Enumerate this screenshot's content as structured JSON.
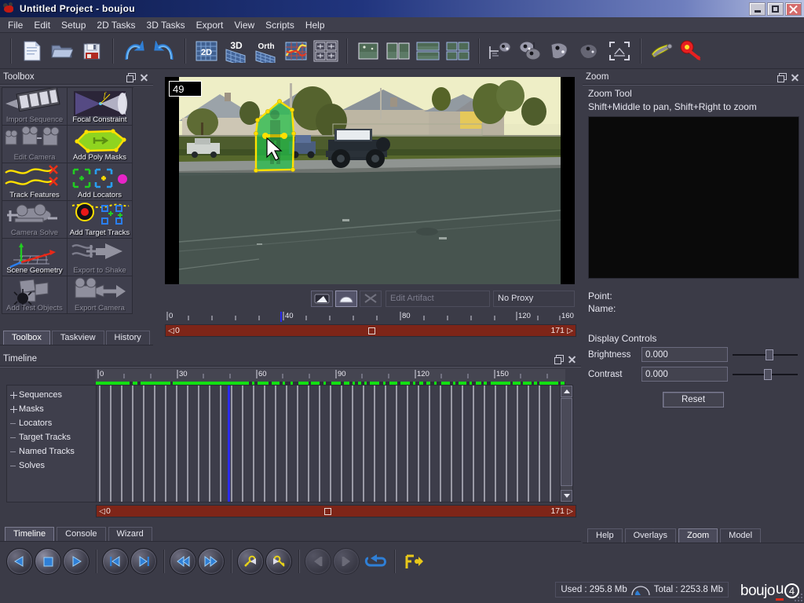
{
  "window": {
    "title": "Untitled Project - boujou",
    "icon": "boujou-app-icon",
    "buttons": {
      "minimize": "minimize",
      "maximize": "maximize",
      "close": "close"
    }
  },
  "menu": {
    "items": [
      "File",
      "Edit",
      "Setup",
      "2D Tasks",
      "3D Tasks",
      "Export",
      "View",
      "Scripts",
      "Help"
    ]
  },
  "toolbar": {
    "groups": [
      {
        "buttons": [
          {
            "name": "new-project-icon",
            "tip": "New"
          },
          {
            "name": "open-project-icon",
            "tip": "Open"
          },
          {
            "name": "save-project-icon",
            "tip": "Save"
          }
        ]
      },
      {
        "buttons": [
          {
            "name": "undo-icon",
            "tip": "Undo"
          },
          {
            "name": "redo-icon",
            "tip": "Redo"
          }
        ]
      },
      {
        "buttons": [
          {
            "name": "view-2d-icon",
            "tip": "2D",
            "label": "2D"
          },
          {
            "name": "view-3d-icon",
            "tip": "3D",
            "label": "3D"
          },
          {
            "name": "view-orth-icon",
            "tip": "Orth",
            "label": "Orth"
          },
          {
            "name": "view-graph-icon",
            "tip": "Graph"
          },
          {
            "name": "view-split-grid-icon",
            "tip": "Quad layout"
          }
        ]
      },
      {
        "buttons": [
          {
            "name": "layout-single-icon",
            "tip": "Single view"
          },
          {
            "name": "layout-two-up-icon",
            "tip": "Two views"
          },
          {
            "name": "layout-stacked-icon",
            "tip": "Stacked views"
          },
          {
            "name": "layout-quad-icon",
            "tip": "Four views"
          }
        ]
      },
      {
        "buttons": [
          {
            "name": "camera-path-icon",
            "tip": "Camera path"
          },
          {
            "name": "multi-camera-icon",
            "tip": "Cameras"
          },
          {
            "name": "camera-single-icon",
            "tip": "Camera"
          },
          {
            "name": "camera-ghost-icon",
            "tip": "Ghost camera"
          },
          {
            "name": "frame-bounds-icon",
            "tip": "Frame selection"
          }
        ]
      },
      {
        "buttons": [
          {
            "name": "mask-paint-icon",
            "tip": "Mask tool"
          },
          {
            "name": "target-track-icon",
            "tip": "Target track tool"
          }
        ]
      }
    ]
  },
  "toolbox": {
    "title": "Toolbox",
    "items": [
      {
        "label": "Import Sequence",
        "icon": "film-strip-icon",
        "enabled": false
      },
      {
        "label": "Focal Constraint",
        "icon": "focal-cone-icon",
        "enabled": true
      },
      {
        "label": "Edit Camera",
        "icon": "cameras-icon",
        "enabled": false
      },
      {
        "label": "Add Poly Masks",
        "icon": "poly-mask-icon",
        "enabled": true
      },
      {
        "label": "Track Features",
        "icon": "track-features-icon",
        "enabled": true
      },
      {
        "label": "Add Locators",
        "icon": "locators-icon",
        "enabled": true
      },
      {
        "label": "Camera Solve",
        "icon": "camera-solve-icon",
        "enabled": false
      },
      {
        "label": "Add Target Tracks",
        "icon": "target-tracks-icon",
        "enabled": true
      },
      {
        "label": "Scene Geometry",
        "icon": "scene-geometry-icon",
        "enabled": true
      },
      {
        "label": "Export to Shake",
        "icon": "export-shake-icon",
        "enabled": false
      },
      {
        "label": "Add Test Objects",
        "icon": "test-objects-icon",
        "enabled": false
      },
      {
        "label": "Export Camera",
        "icon": "export-camera-icon",
        "enabled": false
      }
    ],
    "tabs": [
      {
        "label": "Toolbox",
        "active": true
      },
      {
        "label": "Taskview",
        "active": false
      },
      {
        "label": "History",
        "active": false
      }
    ]
  },
  "viewport": {
    "frame_number": "49",
    "tools": [
      {
        "name": "pan-tool-icon",
        "enabled": true,
        "active": false
      },
      {
        "name": "mask-tool-icon",
        "enabled": true,
        "active": true
      },
      {
        "name": "cut-tool-icon",
        "enabled": false,
        "active": false
      }
    ],
    "artifact_field": {
      "placeholder": "Edit Artifact",
      "value": ""
    },
    "proxy": "No Proxy",
    "ruler": {
      "ticks": [
        0,
        40,
        80,
        120,
        160
      ],
      "min": 0,
      "max": 171,
      "step": 10
    },
    "range": {
      "start": "0",
      "end": "171",
      "current": "49"
    },
    "scene": {
      "description": "Suburban street at golden hour with parked jeep and person highlighted by green poly mask",
      "mask_color": "#22c04a",
      "mask_outline_color": "#ffe000"
    }
  },
  "timeline": {
    "title": "Timeline",
    "tree": [
      {
        "label": "Sequences",
        "expander": "plus"
      },
      {
        "label": "Masks",
        "expander": "plus"
      },
      {
        "label": "Locators",
        "expander": "dot"
      },
      {
        "label": "Target Tracks",
        "expander": "dot"
      },
      {
        "label": "Named Tracks",
        "expander": "dot"
      },
      {
        "label": "Solves",
        "expander": "dot"
      }
    ],
    "ruler": {
      "ticks": [
        0,
        30,
        60,
        90,
        120,
        150
      ],
      "min": 0,
      "max": 171
    },
    "playhead_frame": 49,
    "range": {
      "start": "0",
      "end": "171"
    },
    "tabs": [
      {
        "label": "Timeline",
        "active": true
      },
      {
        "label": "Console",
        "active": false
      },
      {
        "label": "Wizard",
        "active": false
      }
    ]
  },
  "zoom_panel": {
    "title": "Zoom",
    "tool_name": "Zoom Tool",
    "hint": "Shift+Middle to pan, Shift+Right to zoom",
    "point_label": "Point:",
    "point_value": "",
    "name_label": "Name:",
    "name_value": "",
    "display_controls_label": "Display Controls",
    "brightness": {
      "label": "Brightness",
      "value": "0.000",
      "slider_pct": 52
    },
    "contrast": {
      "label": "Contrast",
      "value": "0.000",
      "slider_pct": 50
    },
    "reset_button": "Reset",
    "tabs": [
      {
        "label": "Help",
        "active": false
      },
      {
        "label": "Overlays",
        "active": false
      },
      {
        "label": "Zoom",
        "active": true
      },
      {
        "label": "Model",
        "active": false
      }
    ]
  },
  "playback": {
    "buttons": [
      {
        "name": "play-backward-button",
        "icon": "triangle-left",
        "enabled": true,
        "pressed": false
      },
      {
        "name": "stop-button",
        "icon": "square",
        "enabled": true,
        "pressed": true
      },
      {
        "name": "play-forward-button",
        "icon": "triangle-right",
        "enabled": true,
        "pressed": false
      },
      {
        "name": "step-back-button",
        "icon": "triangle-left-bar",
        "enabled": true,
        "pressed": false
      },
      {
        "name": "step-forward-button",
        "icon": "triangle-right-bar",
        "enabled": true,
        "pressed": false
      },
      {
        "name": "go-to-start-button",
        "icon": "double-left",
        "enabled": true,
        "pressed": false
      },
      {
        "name": "go-to-end-button",
        "icon": "double-right",
        "enabled": true,
        "pressed": false
      },
      {
        "name": "prev-key-button",
        "icon": "key-left",
        "enabled": true,
        "pressed": false
      },
      {
        "name": "next-key-button",
        "icon": "key-right",
        "enabled": true,
        "pressed": false
      },
      {
        "name": "prev-marker-button",
        "icon": "bar-left",
        "enabled": false,
        "pressed": false
      },
      {
        "name": "next-marker-button",
        "icon": "bar-right",
        "enabled": false,
        "pressed": false
      },
      {
        "name": "loop-button",
        "icon": "loop-arrow",
        "enabled": true,
        "pressed": false
      },
      {
        "name": "lock-playback-button",
        "icon": "lock-key",
        "enabled": true,
        "pressed": false
      }
    ]
  },
  "status": {
    "used": "Used : 295.8 Mb",
    "total": "Total : 2253.8 Mb",
    "gauge_icon": "memory-gauge-icon",
    "logo": {
      "text": "boujo",
      "accent_letter": "u",
      "version": "4",
      "accent_color": "#e02b1c"
    }
  }
}
